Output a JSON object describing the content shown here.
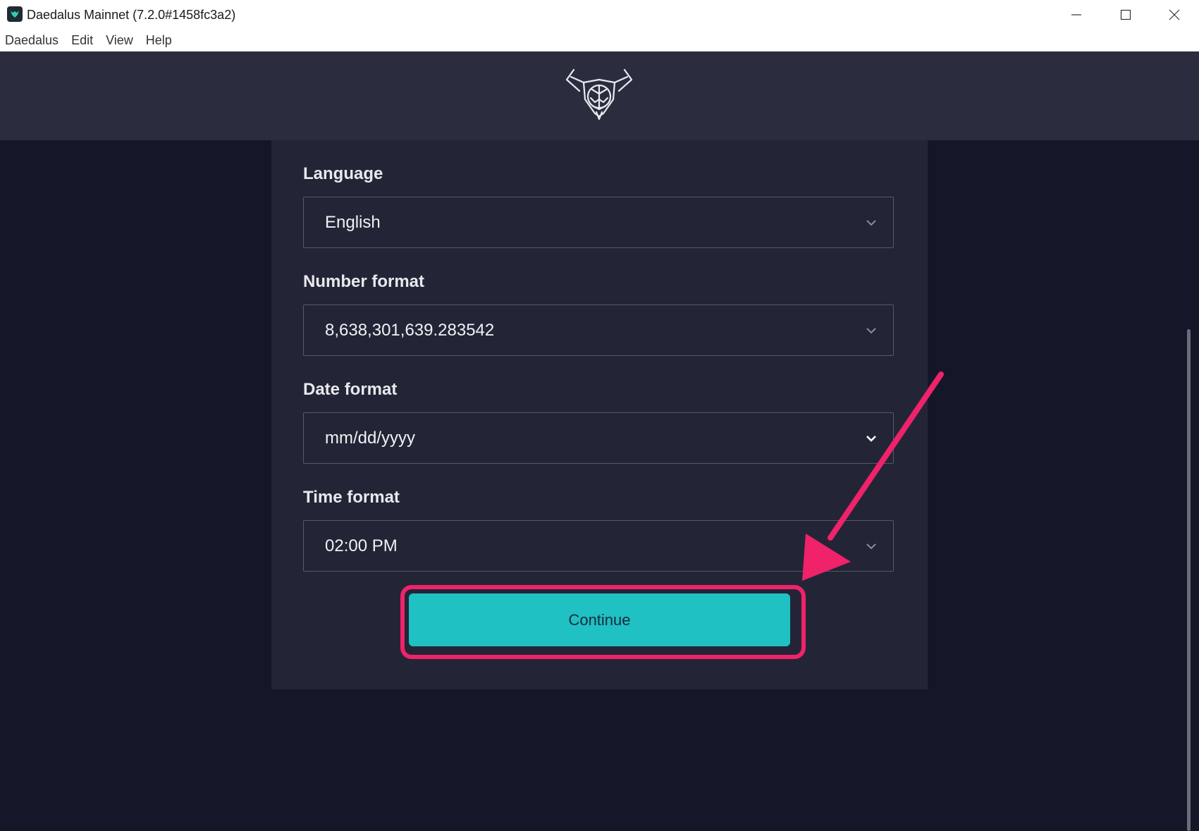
{
  "window": {
    "title": "Daedalus Mainnet (7.2.0#1458fc3a2)"
  },
  "menu": {
    "items": [
      "Daedalus",
      "Edit",
      "View",
      "Help"
    ]
  },
  "form": {
    "language": {
      "label": "Language",
      "value": "English"
    },
    "number_format": {
      "label": "Number format",
      "value": "8,638,301,639.283542"
    },
    "date_format": {
      "label": "Date format",
      "value": "mm/dd/yyyy"
    },
    "time_format": {
      "label": "Time format",
      "value": "02:00 PM"
    },
    "continue_label": "Continue"
  },
  "colors": {
    "accent": "#1fc1c3",
    "annotation": "#f0226a",
    "panel": "#232536",
    "header": "#2b2d3f",
    "background": "#151728"
  },
  "icons": {
    "app": "daedalus-app-icon",
    "logo": "daedalus-bull-logo",
    "chevron": "chevron-down-icon"
  }
}
